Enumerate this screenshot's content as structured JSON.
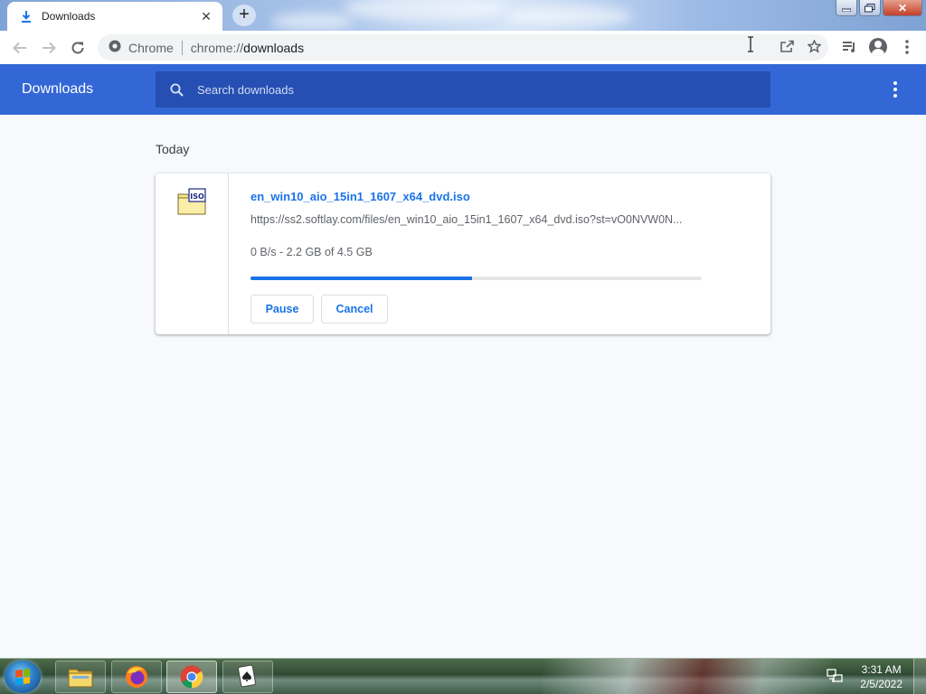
{
  "browser": {
    "tab_title": "Downloads",
    "tab_close": "✕",
    "new_tab": "+",
    "site_label": "Chrome",
    "url_scheme": "chrome://",
    "url_host": "downloads"
  },
  "downloads_page": {
    "title": "Downloads",
    "search_placeholder": "Search downloads",
    "section_title": "Today",
    "items": [
      {
        "file_name": "en_win10_aio_15in1_1607_x64_dvd.iso",
        "url": "https://ss2.softlay.com/files/en_win10_aio_15in1_1607_x64_dvd.iso?st=vO0NVW0N...",
        "status": "0 B/s - 2.2 GB of 4.5 GB",
        "progress_fraction": 0.49,
        "icon_label": "ISO",
        "pause_label": "Pause",
        "cancel_label": "Cancel"
      }
    ]
  },
  "taskbar": {
    "time": "3:31 AM",
    "date": "2/5/2022"
  },
  "colors": {
    "accent": "#1a73e8",
    "header": "#3367d6",
    "search_bg": "#254fb3"
  }
}
